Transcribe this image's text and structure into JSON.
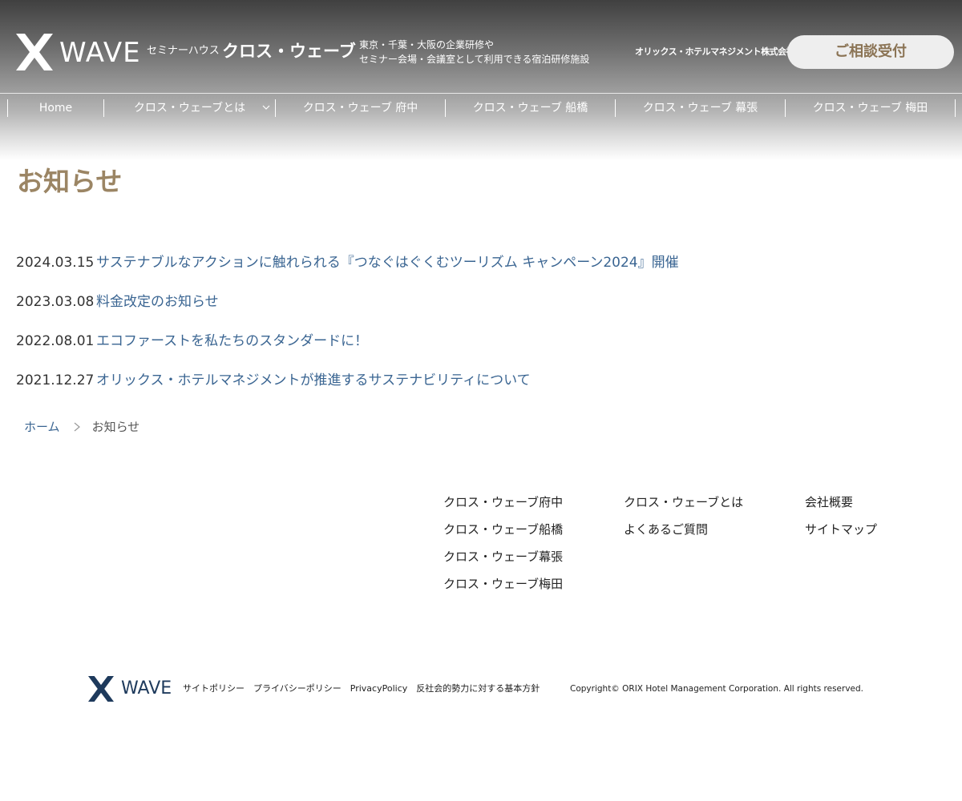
{
  "header": {
    "logo_text": "WAVE",
    "tagline": "セミナーハウス",
    "site_name": "クロス・ウェーブ",
    "description_line1": "東京・千葉・大阪の企業研修や",
    "description_line2": "セミナー会場・会議室として利用できる宿泊研修施設",
    "company": "オリックス・ホテルマネジメント株式会社",
    "consult_button": "ご相談受付",
    "accent_color": "#8b7455"
  },
  "nav": {
    "items": [
      {
        "label": "Home"
      },
      {
        "label": "クロス・ウェーブとは"
      },
      {
        "label": "クロス・ウェーブ 府中"
      },
      {
        "label": "クロス・ウェーブ 船橋"
      },
      {
        "label": "クロス・ウェーブ 幕張"
      },
      {
        "label": "クロス・ウェーブ 梅田"
      }
    ]
  },
  "main": {
    "title": "お知らせ",
    "title_color": "#9b8564",
    "news": [
      {
        "date": "2024.03.15",
        "title": "サステナブルなアクションに触れられる『つなぐはぐくむツーリズム キャンペーン2024』開催"
      },
      {
        "date": "2023.03.08",
        "title": "料金改定のお知らせ"
      },
      {
        "date": "2022.08.01",
        "title": "エコファーストを私たちのスタンダードに！"
      },
      {
        "date": "2021.12.27",
        "title": "オリックス・ホテルマネジメントが推進するサステナビリティについて"
      }
    ],
    "link_color": "#3a6592"
  },
  "breadcrumb": {
    "home": "ホーム",
    "current": "お知らせ"
  },
  "footer": {
    "col1": [
      "クロス・ウェーブ府中",
      "クロス・ウェーブ船橋",
      "クロス・ウェーブ幕張",
      "クロス・ウェーブ梅田"
    ],
    "col2": [
      "クロス・ウェーブとは",
      "よくあるご質問"
    ],
    "col3": [
      "会社概要",
      "サイトマップ"
    ],
    "logo_text": "WAVE",
    "links": [
      "サイトポリシー",
      "プライバシーポリシー",
      "PrivacyPolicy",
      "反社会的勢力に対する基本方針"
    ],
    "copyright": "Copyright© ORIX Hotel Management Corporation. All rights reserved.",
    "brand_color": "#1e3a5c"
  }
}
